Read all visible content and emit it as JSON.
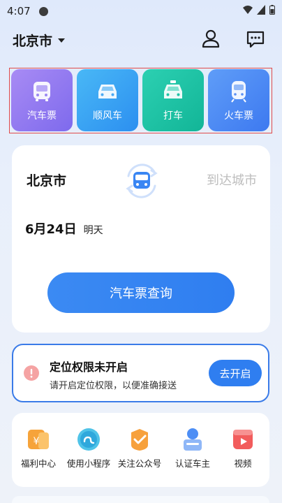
{
  "status_bar": {
    "time": "4:07"
  },
  "header": {
    "city": "北京市"
  },
  "services": [
    {
      "label": "汽车票",
      "icon": "bus-icon"
    },
    {
      "label": "顺风车",
      "icon": "car-icon"
    },
    {
      "label": "打车",
      "icon": "taxi-icon"
    },
    {
      "label": "火车票",
      "icon": "train-icon"
    }
  ],
  "search": {
    "from_city": "北京市",
    "to_city_placeholder": "到达城市",
    "date": "6月24日",
    "date_relative": "明天",
    "query_button": "汽车票查询"
  },
  "location_notice": {
    "title": "定位权限未开启",
    "description": "请开启定位权限，以便准确接送",
    "button": "去开启"
  },
  "shortcuts": [
    {
      "label": "福利中心",
      "icon": "welfare-icon"
    },
    {
      "label": "使用小程序",
      "icon": "mini-program-icon"
    },
    {
      "label": "关注公众号",
      "icon": "official-account-icon"
    },
    {
      "label": "认证车主",
      "icon": "driver-verify-icon"
    },
    {
      "label": "视频",
      "icon": "video-icon"
    }
  ],
  "colors": {
    "primary_blue": "#2f7ef0",
    "bus_purple": "#8a74ef",
    "car_blue": "#3aa2f3",
    "taxi_green": "#1dc2a4",
    "train_blue": "#4a88f3",
    "notice_border": "#3a7be8",
    "highlight_red": "#e04a4a"
  }
}
